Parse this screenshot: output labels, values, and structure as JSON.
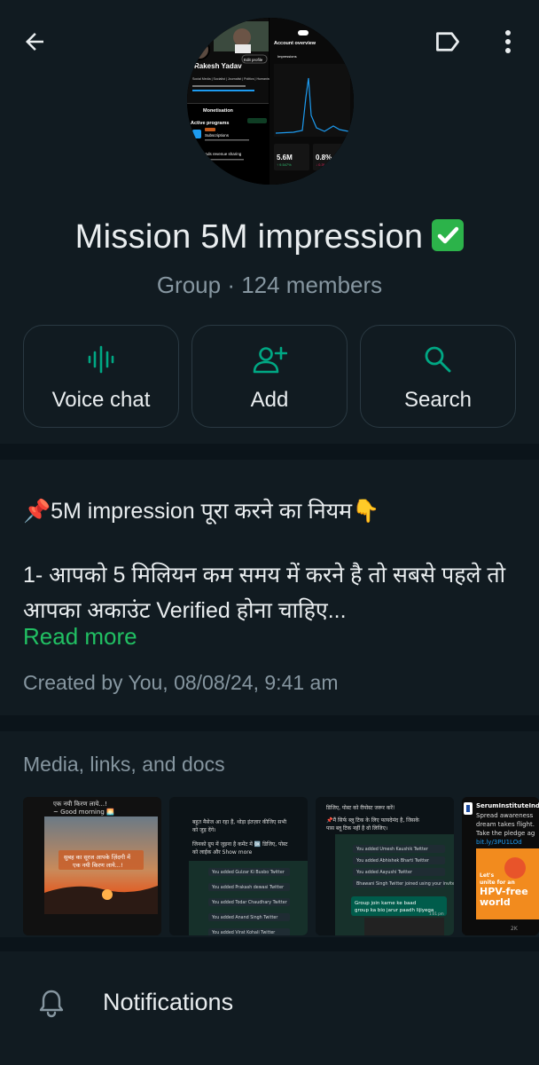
{
  "header": {
    "back_icon": "arrow-left-icon",
    "label_icon": "label-tag-icon",
    "more_icon": "more-vertical-icon"
  },
  "group": {
    "name": "Mission 5M impression",
    "verified_emoji": "✅",
    "meta": "Group · 124 members"
  },
  "avatar_preview": {
    "profile_name": "Rakesh Yadav",
    "edit_profile": "Edit profile",
    "bio": "Social Media | Socialist | Journalist | Politics | Humanist | Writer |",
    "section": "Monetisation",
    "active_programs": "Active programs",
    "subscriptions": "Subscriptions",
    "ads_revenue": "Ads revenue sharing",
    "account_overview": "Account overview",
    "impressions": "Impressions",
    "impressions_value": "5.6M",
    "engagement_value": "0.8%"
  },
  "actions": [
    {
      "label": "Voice chat",
      "icon": "voice-wave-icon"
    },
    {
      "label": "Add",
      "icon": "add-person-icon"
    },
    {
      "label": "Search",
      "icon": "search-icon"
    }
  ],
  "description": {
    "title": "📌5M impression पूरा करने का नियम👇",
    "body": "1- आपको 5 मिलियन कम समय में करने है तो सबसे पहले तो आपका अकाउंट Verified होना चाहिए...",
    "read_more": "Read more",
    "created": "Created by You, 08/08/24, 9:41 am"
  },
  "media": {
    "title": "Media, links, and docs",
    "thumb1": {
      "line1": "एक नयी किरण लाये...!",
      "line2": "~ Good morning 🌅",
      "caption1": "सुबह का सूरज आपके ज़िंदगी में",
      "caption2": "एक नयी किरण लाये...!"
    },
    "thumb2": {
      "line1": "बहुत मैसेज आ रहा हैं, थोड़ा इंतज़ार कीजिए सभी",
      "line2": "को जुड़ देंगे।",
      "line3": "जिनको ग्रुप में जुड़ना है कमेंट में 🆗 डिजिए, पोस्ट",
      "line4": "को लाईक और Show more",
      "rows": [
        "You added Gulzar Ki Busbo Twitter",
        "You added Prakash dewasi Twitter",
        "You added Todar Chaudhary Twitter",
        "You added Anand Singh Twitter",
        "You added Virat Kohali Twitter"
      ]
    },
    "thumb3": {
      "line1": "डिजिए, पोस्ट को रीपोस्ट जरूर करें!",
      "line2": "📌मैं सिर्फ ब्लू टिक के लिए फायदेमंद है, जिसके",
      "line3": "पास ब्लू टिक नहीं है वो लिजिए।",
      "rows": [
        "You added Umesh Kaushik Twitter",
        "You added Abhishek Bharti Twitter",
        "You added Aayushi Twitter",
        "Bhawani Singh Twitter joined using your invite"
      ],
      "msg": "Group join karne ke baad group ka bio jarur paadh lijiyega",
      "time": "1:01 pm"
    },
    "thumb4": {
      "name": "SerumInstituteInd",
      "text1": "Spread awareness",
      "text2": "dream takes flight.",
      "text3": "Take the pledge ag",
      "link": "bit.ly/3PU1LOd",
      "card1": "Let's",
      "card2": "unite for an",
      "card3": "HPV-free",
      "card4": "world",
      "stat": "2K"
    }
  },
  "notifications": {
    "label": "Notifications",
    "icon": "bell-icon"
  },
  "colors": {
    "background": "#0b141a",
    "surface": "#111b21",
    "accent": "#21c063",
    "icon_green": "#00a884",
    "secondary_text": "#8696a0"
  }
}
